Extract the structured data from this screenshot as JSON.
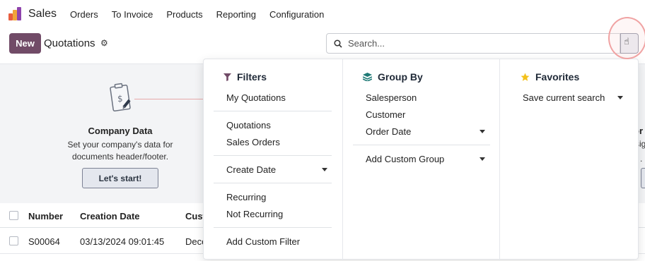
{
  "app": {
    "name": "Sales"
  },
  "nav": [
    "Orders",
    "To Invoice",
    "Products",
    "Reporting",
    "Configuration"
  ],
  "controls": {
    "new_label": "New",
    "page_title": "Quotations",
    "search_placeholder": "Search..."
  },
  "onboarding": {
    "title": "Company Data",
    "text_line1": "Set your company's data for",
    "text_line2": "documents header/footer.",
    "button": "Let's start!",
    "next_title_fragment": "or",
    "next_text_fragment": "sig",
    "next_text_fragment2": "."
  },
  "table": {
    "headers": [
      "Number",
      "Creation Date",
      "Cust"
    ],
    "rows": [
      {
        "number": "S00064",
        "creation_date": "03/13/2024 09:01:45",
        "customer": "Deco"
      }
    ]
  },
  "dropdown": {
    "filters": {
      "title": "Filters",
      "items": [
        "My Quotations",
        "Quotations",
        "Sales Orders",
        "Create Date",
        "Recurring",
        "Not Recurring",
        "Add Custom Filter"
      ]
    },
    "group_by": {
      "title": "Group By",
      "items": [
        "Salesperson",
        "Customer",
        "Order Date",
        "Add Custom Group"
      ]
    },
    "favorites": {
      "title": "Favorites",
      "items": [
        "Save current search"
      ]
    }
  },
  "colors": {
    "primary": "#714b67",
    "accent_star": "#f3c11b",
    "group_icon": "#1f7a76"
  }
}
